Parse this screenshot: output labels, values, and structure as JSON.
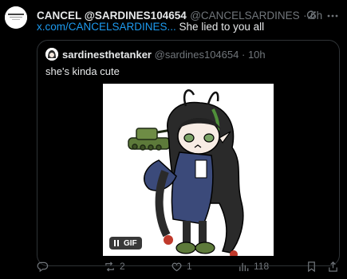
{
  "post": {
    "display_name": "CANCEL @SARDINES104654",
    "handle": "@CANCELSARDINES",
    "separator": "·",
    "time": "6h",
    "link_text": "x.com/CANCELSARDINES...",
    "text_after_link": " She lied to you all"
  },
  "quote": {
    "display_name": "sardinesthetanker",
    "handle": "@sardines104654",
    "separator": "·",
    "time": "10h",
    "text": "she's kinda cute",
    "media_badge": "GIF"
  },
  "actions": {
    "reply": {
      "icon": "reply-icon",
      "count": ""
    },
    "repost": {
      "icon": "repost-icon",
      "count": "2"
    },
    "like": {
      "icon": "heart-icon",
      "count": "1"
    },
    "views": {
      "icon": "views-icon",
      "count": "118"
    },
    "bookmark": {
      "icon": "bookmark-icon"
    },
    "share": {
      "icon": "share-icon"
    }
  },
  "colors": {
    "background": "#000000",
    "text": "#e7e9ea",
    "secondary": "#71767b",
    "link": "#1d9bf0",
    "border": "#2f3336"
  }
}
